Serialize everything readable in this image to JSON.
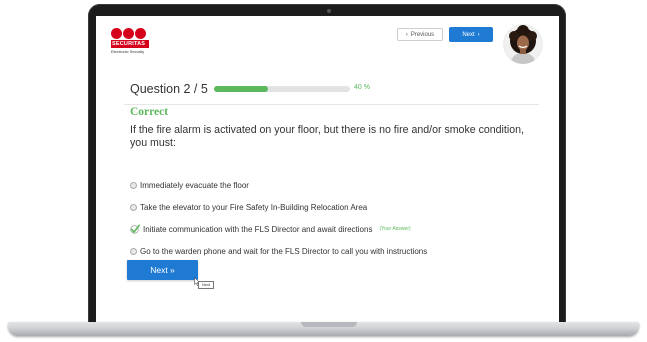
{
  "brand": {
    "name": "SECURITAS",
    "subtitle": "Electronic Security",
    "color": "#d5001c"
  },
  "nav": {
    "previous_label": "Previous",
    "next_label": "Next",
    "previous_icon": "chevron-left-icon",
    "next_icon": "chevron-right-icon",
    "accent": "#1f7ad4"
  },
  "quiz": {
    "question_counter": "Question 2 / 5",
    "progress_percent": 40,
    "progress_text": "40 %",
    "result": "Correct",
    "result_color": "#5cb85c",
    "question": "If the fire alarm is activated on your floor, but there is no fire and/or smoke condition, you must:",
    "options": [
      {
        "text": "Immediately evacuate the floor",
        "selected": false
      },
      {
        "text": "Take the elevator to your Fire Safety In-Building Relocation Area",
        "selected": false
      },
      {
        "text": "Initiate communication with the FLS Director and await directions",
        "selected": true,
        "tag": "(Your Answer)"
      },
      {
        "text": "Go to the warden phone and wait for the FLS Director to call you with instructions",
        "selected": false
      }
    ],
    "next_button_label": "Next »",
    "tooltip": "Next"
  }
}
